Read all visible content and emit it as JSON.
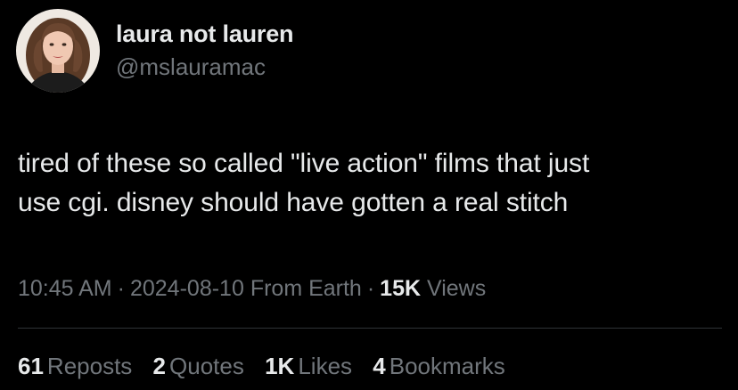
{
  "user": {
    "display_name": "laura not lauren",
    "handle": "@mslauramac"
  },
  "tweet": {
    "text_line1": "tired of these so called \"live action\" films that just",
    "text_line2": "use cgi. disney should have gotten a real stitch"
  },
  "meta": {
    "time": "10:45 AM",
    "date": "2024-08-10",
    "source": "From Earth",
    "separator": "·",
    "views_count": "15K",
    "views_label": "Views"
  },
  "stats": {
    "reposts": {
      "count": "61",
      "label": "Reposts"
    },
    "quotes": {
      "count": "2",
      "label": "Quotes"
    },
    "likes": {
      "count": "1K",
      "label": "Likes"
    },
    "bookmarks": {
      "count": "4",
      "label": "Bookmarks"
    }
  },
  "colors": {
    "background": "#000000",
    "text_primary": "#e7e9ea",
    "text_secondary": "#71767b",
    "divider": "#2f3336"
  }
}
